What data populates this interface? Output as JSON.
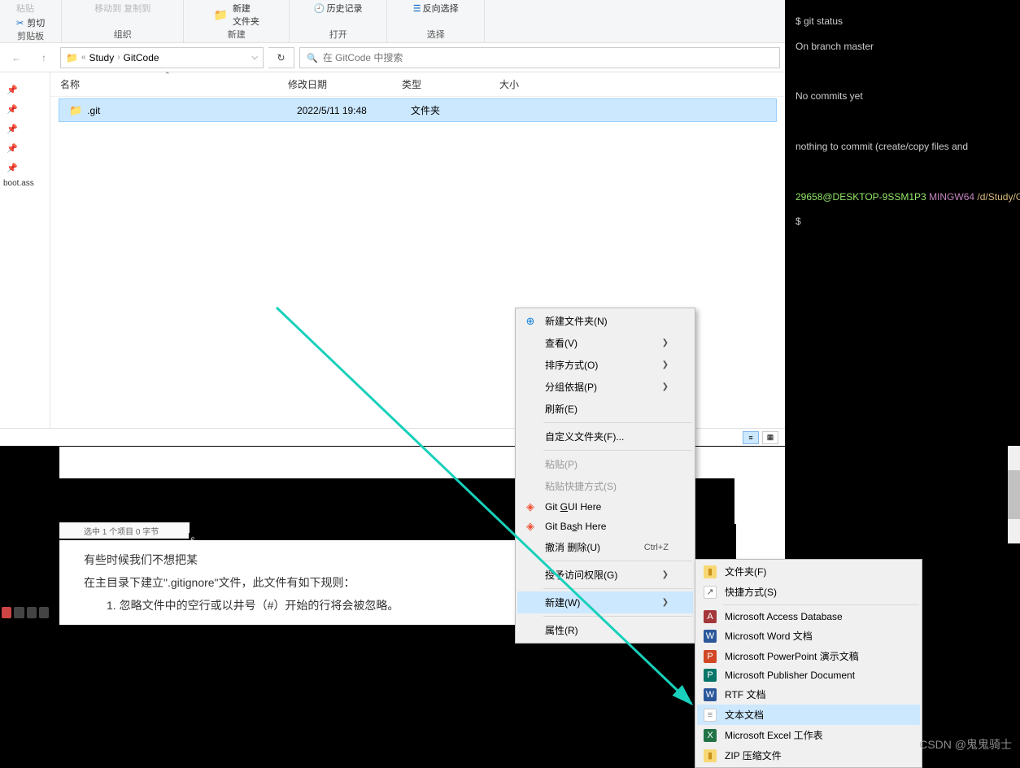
{
  "ribbon": {
    "cut": "剪切",
    "clipboard": "剪贴板",
    "org": "组织",
    "new_folder": "新建\n文件夹",
    "new": "新建",
    "open": "打开",
    "history": "历史记录",
    "select": "选择",
    "invert": "反向选择",
    "top_gray1": "移动到 复制到"
  },
  "breadcrumb": {
    "sep": "«",
    "p1": "Study",
    "p2": "GitCode"
  },
  "search": {
    "placeholder": "在 GitCode 中搜索"
  },
  "columns": {
    "name": "名称",
    "date": "修改日期",
    "type": "类型",
    "size": "大小"
  },
  "file": {
    "name": ".git",
    "date": "2022/5/11 19:48",
    "type": "文件夹",
    "size": ""
  },
  "sidebar_bottom": "boot.ass",
  "terminal": {
    "l1": "$ git status",
    "l2": "On branch master",
    "l3": "No commits yet",
    "l4": "nothing to commit (create/copy files and",
    "prompt_user": "29658@DESKTOP-9SSM1P3",
    "prompt_sys": "MINGW64",
    "prompt_path": "/d/Study/G",
    "dollar": "$"
  },
  "article": {
    "status": "选中 1 个项目  0 字节",
    "prompt_char": "$",
    "l1": "有些时候我们不想把某",
    "l2": "在主目录下建立\".gitignore\"文件，此文件有如下规则：",
    "l3": "1. 忽略文件中的空行或以井号（#）开始的行将会被忽略。"
  },
  "ctx": {
    "new_folder": "新建文件夹(N)",
    "view": "查看(V)",
    "sort": "排序方式(O)",
    "group": "分组依据(P)",
    "refresh": "刷新(E)",
    "customize": "自定义文件夹(F)...",
    "paste": "粘贴(P)",
    "paste_shortcut": "粘贴快捷方式(S)",
    "git_gui": "Git GUI Here",
    "git_bash": "Git Bash Here",
    "undo": "撤消 删除(U)",
    "undo_key": "Ctrl+Z",
    "grant": "授予访问权限(G)",
    "new": "新建(W)",
    "props": "属性(R)"
  },
  "submenu": {
    "folder": "文件夹(F)",
    "shortcut": "快捷方式(S)",
    "access": "Microsoft Access Database",
    "word": "Microsoft Word 文档",
    "ppt": "Microsoft PowerPoint 演示文稿",
    "pub": "Microsoft Publisher Document",
    "rtf": "RTF 文档",
    "txt": "文本文档",
    "excel": "Microsoft Excel 工作表",
    "zip": "ZIP 压缩文件"
  },
  "watermark": "CSDN @鬼鬼骑士"
}
